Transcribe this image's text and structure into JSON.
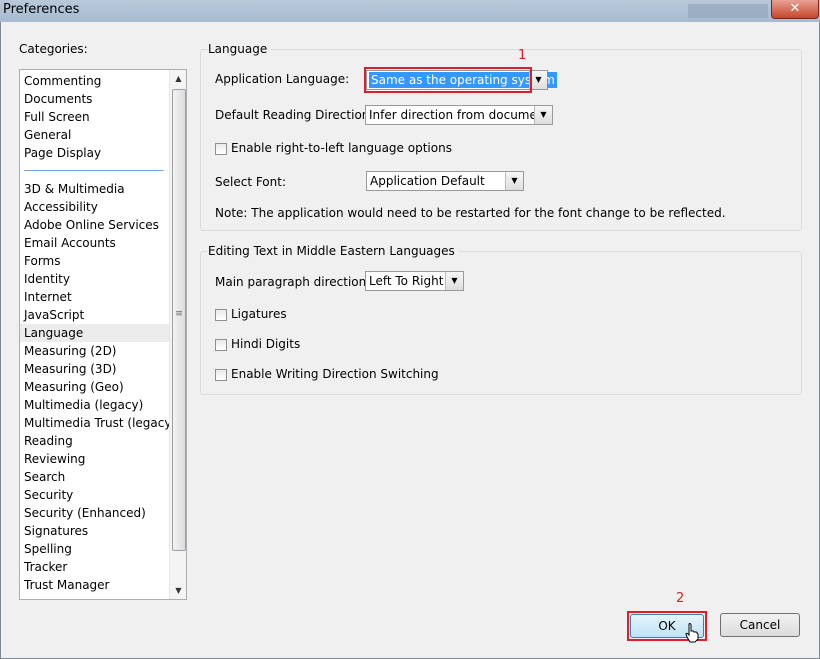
{
  "window": {
    "title": "Preferences",
    "close_label": "✕"
  },
  "categories": {
    "label": "Categories:",
    "items_top": [
      "Commenting",
      "Documents",
      "Full Screen",
      "General",
      "Page Display"
    ],
    "items": [
      "3D & Multimedia",
      "Accessibility",
      "Adobe Online Services",
      "Email Accounts",
      "Forms",
      "Identity",
      "Internet",
      "JavaScript",
      "Language",
      "Measuring (2D)",
      "Measuring (3D)",
      "Measuring (Geo)",
      "Multimedia (legacy)",
      "Multimedia Trust (legacy)",
      "Reading",
      "Reviewing",
      "Search",
      "Security",
      "Security (Enhanced)",
      "Signatures",
      "Spelling",
      "Tracker",
      "Trust Manager"
    ],
    "selected": "Language"
  },
  "language_group": {
    "title": "Language",
    "app_language_label": "Application Language:",
    "app_language_value": "Same as the operating system",
    "reading_direction_label": "Default Reading Direction:",
    "reading_direction_value": "Infer direction from document",
    "rtl_checkbox_label": "Enable right-to-left language options",
    "rtl_checked": false,
    "select_font_label": "Select Font:",
    "select_font_value": "Application Default",
    "note": "Note: The application would need to be restarted for the font change to be reflected."
  },
  "middle_eastern_group": {
    "title": "Editing Text in Middle Eastern Languages",
    "paragraph_direction_label": "Main paragraph direction:",
    "paragraph_direction_value": "Left To Right",
    "ligatures_label": "Ligatures",
    "hindi_digits_label": "Hindi Digits",
    "writing_direction_label": "Enable Writing Direction Switching"
  },
  "annotations": {
    "marker_1": "1",
    "marker_2": "2"
  },
  "buttons": {
    "ok": "OK",
    "cancel": "Cancel"
  },
  "colors": {
    "highlight": "#3399ff",
    "annotation_red": "#e01e2a",
    "selected_row": "#ececec"
  }
}
